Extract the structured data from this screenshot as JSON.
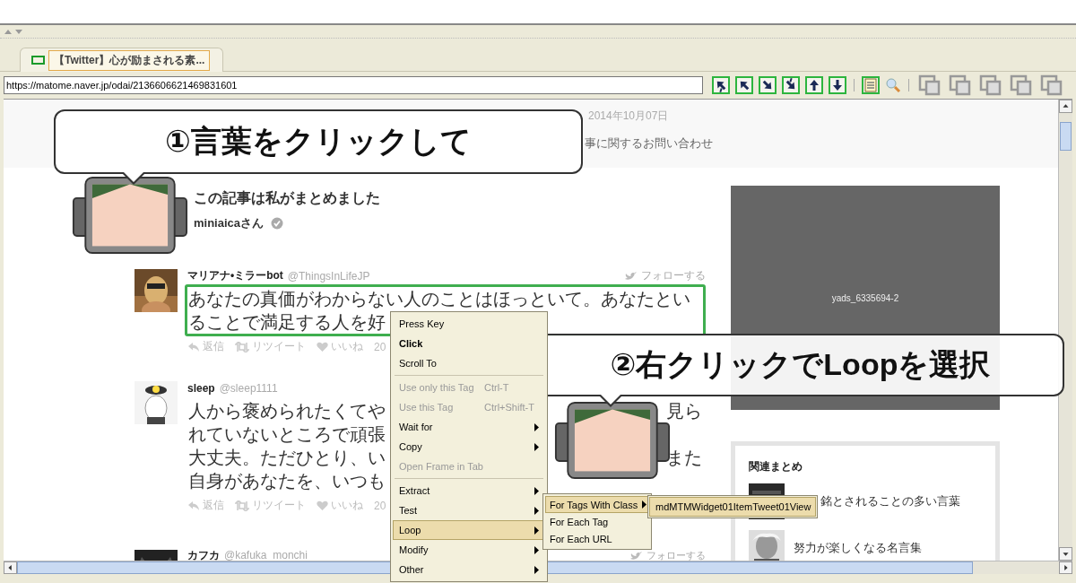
{
  "tab": {
    "label": "【Twitter】心が励まされる素...",
    "selected": true
  },
  "address_bar": {
    "value": "https://matome.naver.jp/odai/2136606621469831601"
  },
  "page_header": {
    "date": "2014年10月07日",
    "contact_link": "事に関するお問い合わせ"
  },
  "author_block": {
    "title": "この記事は私がまとめました",
    "author": "miniaicaさん"
  },
  "tweets": [
    {
      "name": "マリアナ•ミラーbot",
      "handle": "@ThingsInLifeJP",
      "follow": "フォローする",
      "highlighted": true,
      "lines": [
        {
          "left": "あなたの真価がわからない人のことはほっといて。あなたとい"
        },
        {
          "left": "ることで満足する人を好"
        }
      ],
      "actions": [
        "返信",
        "リツイート",
        "いいね",
        "20"
      ]
    },
    {
      "name": "sleep",
      "handle": "@sleep1111",
      "highlighted": false,
      "lines": [
        {
          "left": "人から褒められたくてや",
          "right": "見ら"
        },
        {
          "left": "れていないところで頑張"
        },
        {
          "left": "大丈夫。ただひとり、い",
          "right": "また"
        },
        {
          "left": "自身があなたを、いつも"
        }
      ],
      "actions": [
        "返信",
        "リツイート",
        "いいね",
        "20"
      ]
    },
    {
      "name": "カフカ",
      "handle": "@kafuka_monchi",
      "follow": "フォローする"
    }
  ],
  "ad": {
    "label": "yads_6335694-2"
  },
  "related": {
    "title": "関連まとめ",
    "items": [
      {
        "title": "銘とされることの多い言葉"
      },
      {
        "title": "努力が楽しくなる名言集"
      }
    ]
  },
  "context_menu": {
    "items": [
      {
        "kind": "item",
        "label": "Press Key",
        "default": false,
        "disabled": false,
        "submenu": false,
        "selected": false
      },
      {
        "kind": "item",
        "label": "Click",
        "default": true,
        "disabled": false,
        "submenu": false,
        "selected": false
      },
      {
        "kind": "item",
        "label": "Scroll To",
        "default": false,
        "disabled": false,
        "submenu": false,
        "selected": false
      },
      {
        "kind": "separator"
      },
      {
        "kind": "item",
        "label": "Use only this Tag",
        "shortcut": "Ctrl-T",
        "default": false,
        "disabled": true,
        "submenu": false,
        "selected": false
      },
      {
        "kind": "item",
        "label": "Use this Tag",
        "shortcut": "Ctrl+Shift-T",
        "default": false,
        "disabled": true,
        "submenu": false,
        "selected": false
      },
      {
        "kind": "item",
        "label": "Wait for",
        "default": false,
        "disabled": false,
        "submenu": true,
        "selected": false
      },
      {
        "kind": "item",
        "label": "Copy",
        "default": false,
        "disabled": false,
        "submenu": true,
        "selected": false
      },
      {
        "kind": "item",
        "label": "Open Frame in Tab",
        "default": false,
        "disabled": true,
        "submenu": false,
        "selected": false
      },
      {
        "kind": "separator"
      },
      {
        "kind": "item",
        "label": "Extract",
        "default": false,
        "disabled": false,
        "submenu": true,
        "selected": false
      },
      {
        "kind": "item",
        "label": "Test",
        "default": false,
        "disabled": false,
        "submenu": true,
        "selected": false
      },
      {
        "kind": "item",
        "label": "Loop",
        "default": false,
        "disabled": false,
        "submenu": true,
        "selected": true
      },
      {
        "kind": "item",
        "label": "Modify",
        "default": false,
        "disabled": false,
        "submenu": true,
        "selected": false
      },
      {
        "kind": "item",
        "label": "Other",
        "default": false,
        "disabled": false,
        "submenu": true,
        "selected": false
      }
    ]
  },
  "submenu": {
    "items": [
      {
        "label": "For Tags With Class",
        "submenu": true,
        "selected": true
      },
      {
        "label": "For Each Tag",
        "submenu": false,
        "selected": false
      },
      {
        "label": "For Each URL",
        "submenu": false,
        "selected": false
      }
    ]
  },
  "sub_submenu": {
    "items": [
      {
        "label": "mdMTMWidget01ItemTweet01View",
        "selected": true
      }
    ]
  },
  "callouts": [
    {
      "text": "①言葉をクリックして"
    },
    {
      "text": "②右クリックでLoopを選択"
    }
  ]
}
